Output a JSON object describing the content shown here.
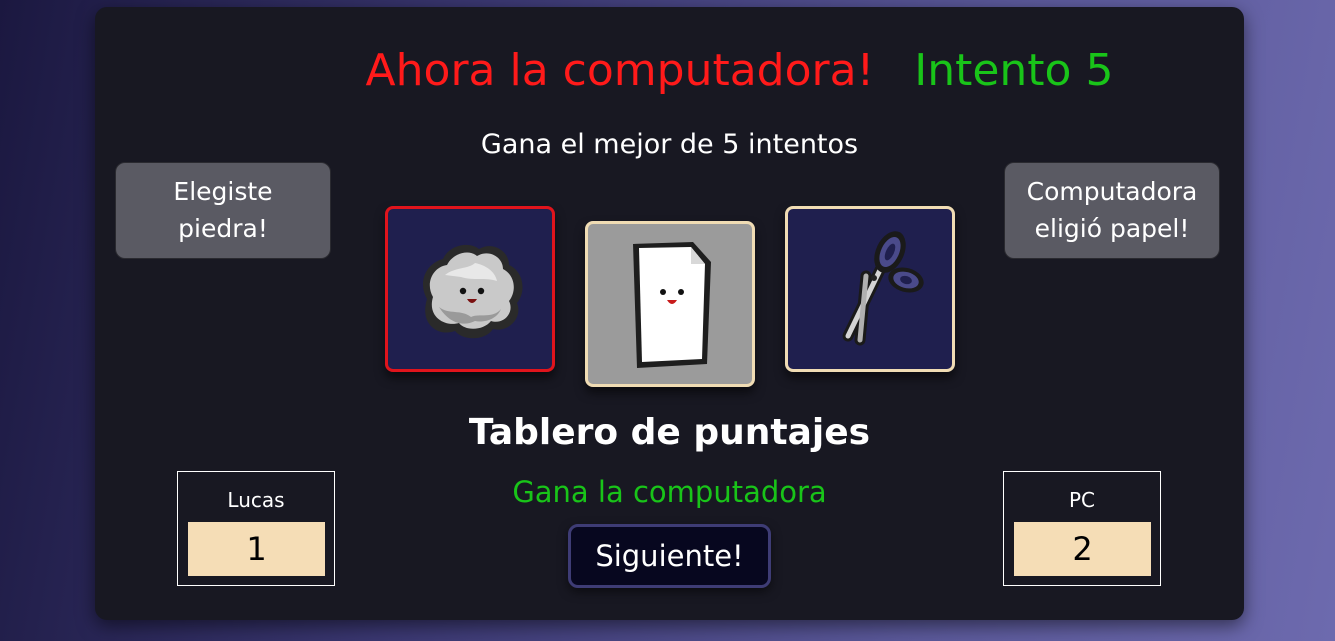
{
  "header": {
    "title": "Ahora la computadora!",
    "attempt": "Intento 5",
    "subtitle": "Gana el mejor de 5 intentos"
  },
  "player_choice": {
    "text": "Elegiste piedra!"
  },
  "computer_choice": {
    "text": "Computadora eligió papel!"
  },
  "options": [
    {
      "name": "piedra",
      "icon": "rock-icon",
      "selected_by": "player"
    },
    {
      "name": "papel",
      "icon": "paper-icon",
      "selected_by": "computer"
    },
    {
      "name": "tijera",
      "icon": "scissors-icon",
      "selected_by": ""
    }
  ],
  "scoreboard": {
    "title": "Tablero de puntajes",
    "result": "Gana la computadora",
    "next_label": "Siguiente!",
    "player": {
      "name": "Lucas",
      "score": "1"
    },
    "computer": {
      "name": "PC",
      "score": "2"
    }
  },
  "colors": {
    "title": "#ff1a1a",
    "attempt": "#19c419",
    "result": "#19c419",
    "selected_border": "#e0141c",
    "option_border": "#f0dcb4",
    "score_bg": "#f5ddb6"
  }
}
